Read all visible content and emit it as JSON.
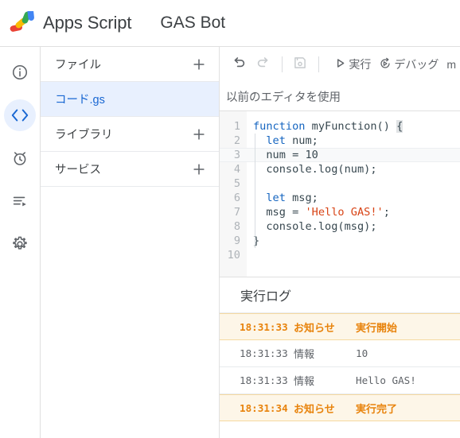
{
  "header": {
    "logo_icon": "apps-script-logo",
    "brand": "Apps Script",
    "project_title": "GAS Bot"
  },
  "rail": {
    "items": [
      {
        "icon": "info-circle-icon",
        "label": "概要",
        "active": false
      },
      {
        "icon": "code-brackets-icon",
        "label": "エディタ",
        "active": true
      },
      {
        "icon": "alarm-clock-icon",
        "label": "トリガー",
        "active": false
      },
      {
        "icon": "execution-list-icon",
        "label": "実行数",
        "active": false
      },
      {
        "icon": "gear-icon",
        "label": "プロジェクトの設定",
        "active": false
      }
    ]
  },
  "file_panel": {
    "sections": [
      {
        "label": "ファイル",
        "add_icon": "plus-icon",
        "has_add": true
      },
      {
        "label": "ライブラリ",
        "add_icon": "plus-icon",
        "has_add": true
      },
      {
        "label": "サービス",
        "add_icon": "plus-icon",
        "has_add": true
      }
    ],
    "selected_file": "コード.gs"
  },
  "toolbar": {
    "undo_icon": "undo-arrow-icon",
    "redo_icon": "redo-arrow-icon",
    "save_icon": "save-floppy-icon",
    "run_icon": "play-triangle-icon",
    "run_label": "実行",
    "debug_icon": "debug-icon",
    "debug_label": "デバッグ",
    "function_select_value": "m",
    "legacy_editor_label": "以前のエディタを使用"
  },
  "editor": {
    "active_line": 3,
    "lines": [
      {
        "n": "1",
        "tokens": [
          {
            "t": "function ",
            "c": "kw"
          },
          {
            "t": "myFunction() ",
            "c": "pun"
          },
          {
            "t": "{",
            "c": "br-hl"
          }
        ]
      },
      {
        "n": "2",
        "tokens": [
          {
            "t": "  ",
            "c": "pun"
          },
          {
            "t": "let",
            "c": "kw"
          },
          {
            "t": " num;",
            "c": "pun"
          }
        ]
      },
      {
        "n": "3",
        "tokens": [
          {
            "t": "  num = 10",
            "c": "pun"
          }
        ]
      },
      {
        "n": "4",
        "tokens": [
          {
            "t": "  console.log(num);",
            "c": "pun"
          }
        ]
      },
      {
        "n": "5",
        "tokens": [
          {
            "t": "",
            "c": "pun"
          }
        ]
      },
      {
        "n": "6",
        "tokens": [
          {
            "t": "  ",
            "c": "pun"
          },
          {
            "t": "let",
            "c": "kw"
          },
          {
            "t": " msg;",
            "c": "pun"
          }
        ]
      },
      {
        "n": "7",
        "tokens": [
          {
            "t": "  msg = ",
            "c": "pun"
          },
          {
            "t": "'Hello GAS!'",
            "c": "str"
          },
          {
            "t": ";",
            "c": "pun"
          }
        ]
      },
      {
        "n": "8",
        "tokens": [
          {
            "t": "  console.log(msg);",
            "c": "pun"
          }
        ]
      },
      {
        "n": "9",
        "tokens": [
          {
            "t": "}",
            "c": "pun"
          }
        ]
      },
      {
        "n": "10",
        "tokens": [
          {
            "t": "",
            "c": "pun"
          }
        ]
      }
    ]
  },
  "log_panel": {
    "title": "実行ログ",
    "rows": [
      {
        "time": "18:31:33",
        "type": "お知らせ",
        "message": "実行開始",
        "level": "notice"
      },
      {
        "time": "18:31:33",
        "type": "情報",
        "message": "10",
        "level": "info"
      },
      {
        "time": "18:31:33",
        "type": "情報",
        "message": "Hello GAS!",
        "level": "info"
      },
      {
        "time": "18:31:34",
        "type": "お知らせ",
        "message": "実行完了",
        "level": "notice"
      }
    ]
  },
  "colors": {
    "accent_blue": "#1967d2",
    "selected_bg": "#e8f0fe",
    "notice_orange": "#e8830c",
    "notice_bg": "#fdf6e8",
    "border": "#e0e0e0",
    "text": "#3c4043",
    "muted_text": "#5f6368",
    "keyword_blue": "#1565c0",
    "string_orange": "#d84315"
  }
}
